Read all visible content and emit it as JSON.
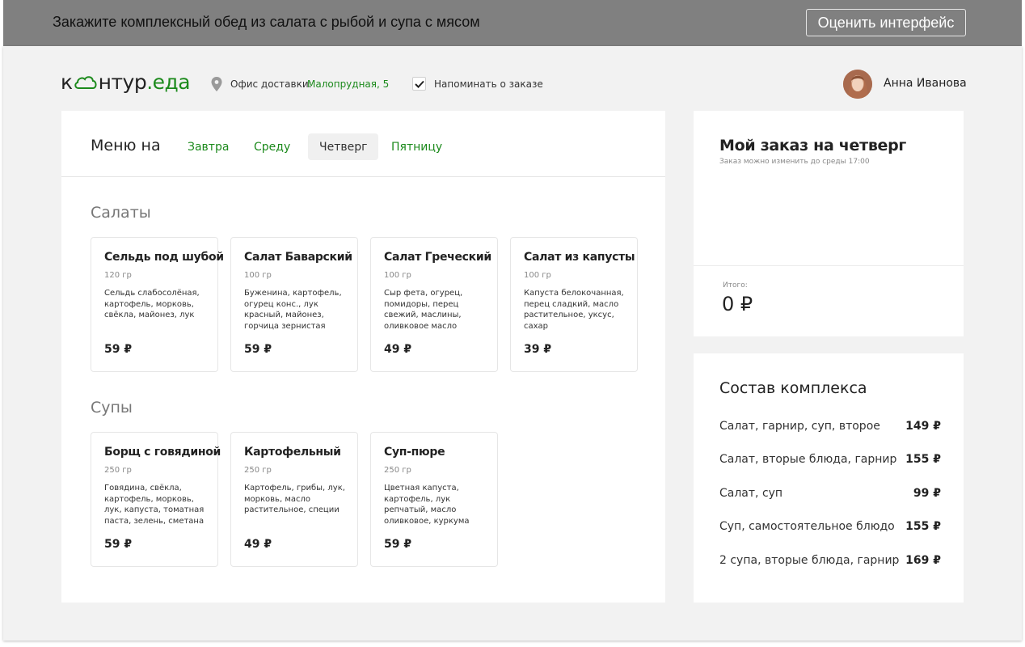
{
  "task": {
    "text": "Закажите комплексный обед из салата с рыбой и супа с мясом",
    "rate_button": "Оценить интерфейс"
  },
  "header": {
    "logo_prefix": "к",
    "logo_mid": "нтур",
    "logo_suffix": ".еда",
    "office_label": "Офис доставки:",
    "office_value": "Малопрудная, 5",
    "remind_checked": true,
    "remind_label": "Напоминать о заказе",
    "user_name": "Анна Иванова"
  },
  "menu": {
    "title": "Меню на",
    "tabs": [
      {
        "label": "Завтра",
        "active": false
      },
      {
        "label": "Среду",
        "active": false
      },
      {
        "label": "Четверг",
        "active": true
      },
      {
        "label": "Пятницу",
        "active": false
      }
    ],
    "sections": [
      {
        "title": "Салаты",
        "dishes": [
          {
            "name": "Сельдь под шубой",
            "weight": "120 гр",
            "desc": "Сельдь слабосолёная, картофель, морковь, свёкла, майонез, лук",
            "price": "59 ₽"
          },
          {
            "name": "Салат Баварский",
            "weight": "100 гр",
            "desc": "Буженина, картофель, огурец конс., лук красный, майонез, горчица зернистая",
            "price": "59 ₽"
          },
          {
            "name": "Салат Греческий",
            "weight": "100 гр",
            "desc": "Сыр фета, огурец, помидоры, перец свежий, маслины, оливковое масло",
            "price": "49 ₽"
          },
          {
            "name": "Салат из капусты",
            "weight": "100 гр",
            "desc": "Капуста белокочанная, перец сладкий, масло растительное, уксус, сахар",
            "price": "39 ₽"
          }
        ]
      },
      {
        "title": "Супы",
        "dishes": [
          {
            "name": "Борщ с говядиной",
            "weight": "250 гр",
            "desc": "Говядина, свёкла, картофель, морковь, лук, капуста, томатная паста, зелень, сметана",
            "price": "59 ₽"
          },
          {
            "name": "Картофельный",
            "weight": "250 гр",
            "desc": "Картофель, грибы, лук, морковь, масло растительное, специи",
            "price": "49 ₽"
          },
          {
            "name": "Суп-пюре",
            "weight": "250 гр",
            "desc": "Цветная капуста, картофель, лук репчатый, масло оливковое, куркума",
            "price": "59 ₽"
          }
        ]
      }
    ]
  },
  "order": {
    "title": "Мой заказ на четверг",
    "subtitle": "Заказ можно изменить до среды 17:00",
    "total_label": "Итого:",
    "total_value": "0 ₽"
  },
  "combos": {
    "title": "Состав комплекса",
    "items": [
      {
        "name": "Салат, гарнир, суп, второе",
        "price": "149 ₽"
      },
      {
        "name": "Салат, вторые блюда, гарнир",
        "price": "155 ₽"
      },
      {
        "name": "Салат, суп",
        "price": "99 ₽"
      },
      {
        "name": "Суп, самостоятельное блюдо",
        "price": "155 ₽"
      },
      {
        "name": "2 супа, вторые блюда, гарнир",
        "price": "169 ₽"
      }
    ]
  },
  "colors": {
    "accent": "#1c8a1c",
    "taskbar": "#808080",
    "app_bg": "#f2f2f2"
  }
}
